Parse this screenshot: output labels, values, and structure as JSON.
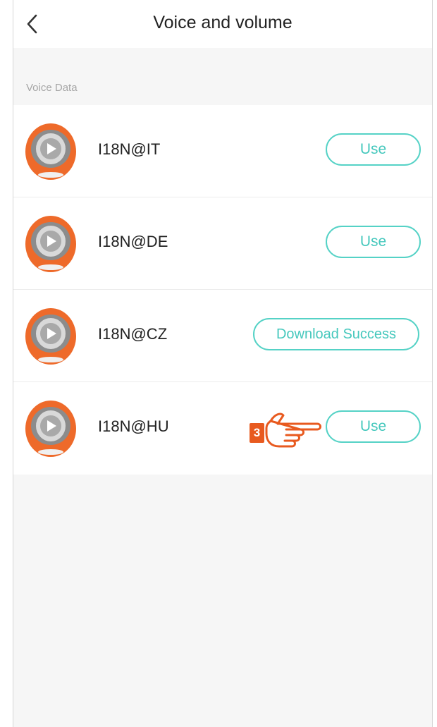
{
  "header": {
    "title": "Voice and volume",
    "back_icon": "chevron-left-icon"
  },
  "section": {
    "label": "Voice Data"
  },
  "voices": [
    {
      "name": "I18N@IT",
      "action": "Use"
    },
    {
      "name": "I18N@DE",
      "action": "Use"
    },
    {
      "name": "I18N@CZ",
      "action": "Download Success"
    },
    {
      "name": "I18N@HU",
      "action": "Use"
    }
  ],
  "annotation": {
    "step": "3",
    "icon": "pointing-hand-icon"
  },
  "colors": {
    "accent": "#55d2c6",
    "accent_text": "#46c8bd",
    "avatar_orange": "#ee6a2a",
    "annotation_orange": "#e85a1f",
    "page_bg": "#f6f6f6"
  }
}
